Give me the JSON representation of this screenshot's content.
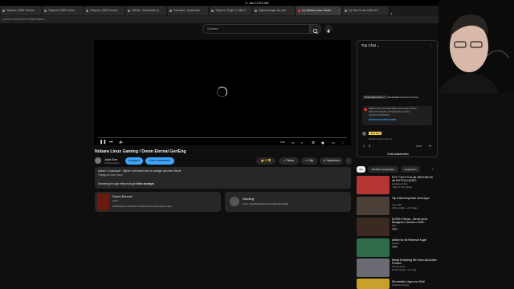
{
  "clock": "5. Jan 10:53 AM",
  "tabs": [
    {
      "label": "Teleport | OBS Forums"
    },
    {
      "label": "Teleport | OBS Forum"
    },
    {
      "label": "Teleport | OBS Forums"
    },
    {
      "label": "GitHub - fenwchildo-m"
    },
    {
      "label": "Releases · fenwchildo"
    },
    {
      "label": "Teleport | Page 2 | OBS F"
    },
    {
      "label": "teleport plugin obs aurl"
    },
    {
      "label": "(1) Nobara Linux Gamin"
    },
    {
      "label": "(1) How to use AMD AV1"
    }
  ],
  "url": "youtube.com/watch?v=ZBeae288dc4",
  "search": {
    "placeholder": "Suchen"
  },
  "video": {
    "title": "Nobara Linux Gaming / Doom Eternal Ger/Eng",
    "channel": "Julie Eve",
    "subscribers": "0 Abonnenten",
    "analytics_label": "Analysen",
    "edit_label": "Video bearbeiten",
    "likes": "0",
    "share_label": "Teilen",
    "clip_label": "Clip",
    "save_label": "Speichern",
    "time": "0:00"
  },
  "description": {
    "line1": "Aktuell 1 Zuschauer · Aktiver Livestream seit vor weniger als einer Minute",
    "line2": "Playing on Arch Linux",
    "line3": "Streaming through teleport plugin",
    "more": "Mehr anzeigen"
  },
  "cards": [
    {
      "title": "Doom Eternal",
      "sub": "2020",
      "link": "WEITERE ZU DIESEM VIDEOSPIEL DURCHSUCHEN"
    },
    {
      "title": "Gaming",
      "link": "ALLE GAMINGINHALTE DURCHSUCHEN"
    }
  ],
  "chat": {
    "header": "Top Chat",
    "msg_author": "StreamElements",
    "msg_text": "StreamElements bot running",
    "banner_line1": "Willkommen im Livechat! Bitte achte auf den Schutz",
    "banner_line2": "deiner Privatsphäre und halte dich an unsere",
    "banner_line3": "Community-Richtlinien.",
    "banner_link": "WEITERE INFORMATIONEN",
    "user": "Julie Eve",
    "input_placeholder": "Gib hier deinen Text ein...",
    "counter": "0/200",
    "hide_label": "Chat ausblenden"
  },
  "chips": [
    "Alle",
    "Kürzlich hochgeladen",
    "Angesehen"
  ],
  "recommendations": [
    {
      "title": "RTX™ 4070 Ti ist da! 499 EURO für die MITTELKLASSE?",
      "channel": "Hardware Unbox",
      "meta": "7 Std. 47 Tsd. Aufrufe"
    },
    {
      "title": "Top 5 Most Important Linux Apps",
      "channel": "Linux Cast",
      "meta": "1 Mio. Aufrufe · vor 3 Tagen"
    },
    {
      "title": "DOOM ft. Bozza - Sterne (prod. Bozagena x Deezus x Tarek...",
      "channel": "Bozz",
      "meta": "Neu"
    },
    {
      "title": "Ablöse für die Riesende Kugel",
      "channel": "Phased",
      "meta": "Neu"
    },
    {
      "title": "Mostly Everything We Know About Blue Protocol",
      "channel": "Gaming Linux",
      "meta": "94 Tsd. Aufrufe · vor 1 Tag"
    },
    {
      "title": "Die dreisten Lügen von Shell",
      "channel": "Kopfbeantwortung",
      "meta": "Neu"
    }
  ],
  "colors": {
    "background": "#0f0f0f",
    "accent_blue": "#3ea6ff",
    "active_tab_icon": "#e03030"
  }
}
